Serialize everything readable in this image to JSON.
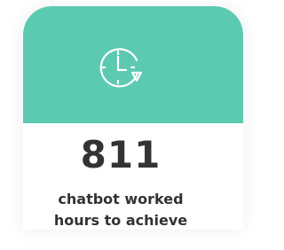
{
  "stat": {
    "value": "811",
    "caption_line1": "chatbot worked",
    "caption_line2": "hours to achieve"
  },
  "icon": {
    "name": "clock-icon"
  },
  "colors": {
    "accent": "#5ccab0",
    "text": "#333333",
    "background": "#ffffff"
  }
}
